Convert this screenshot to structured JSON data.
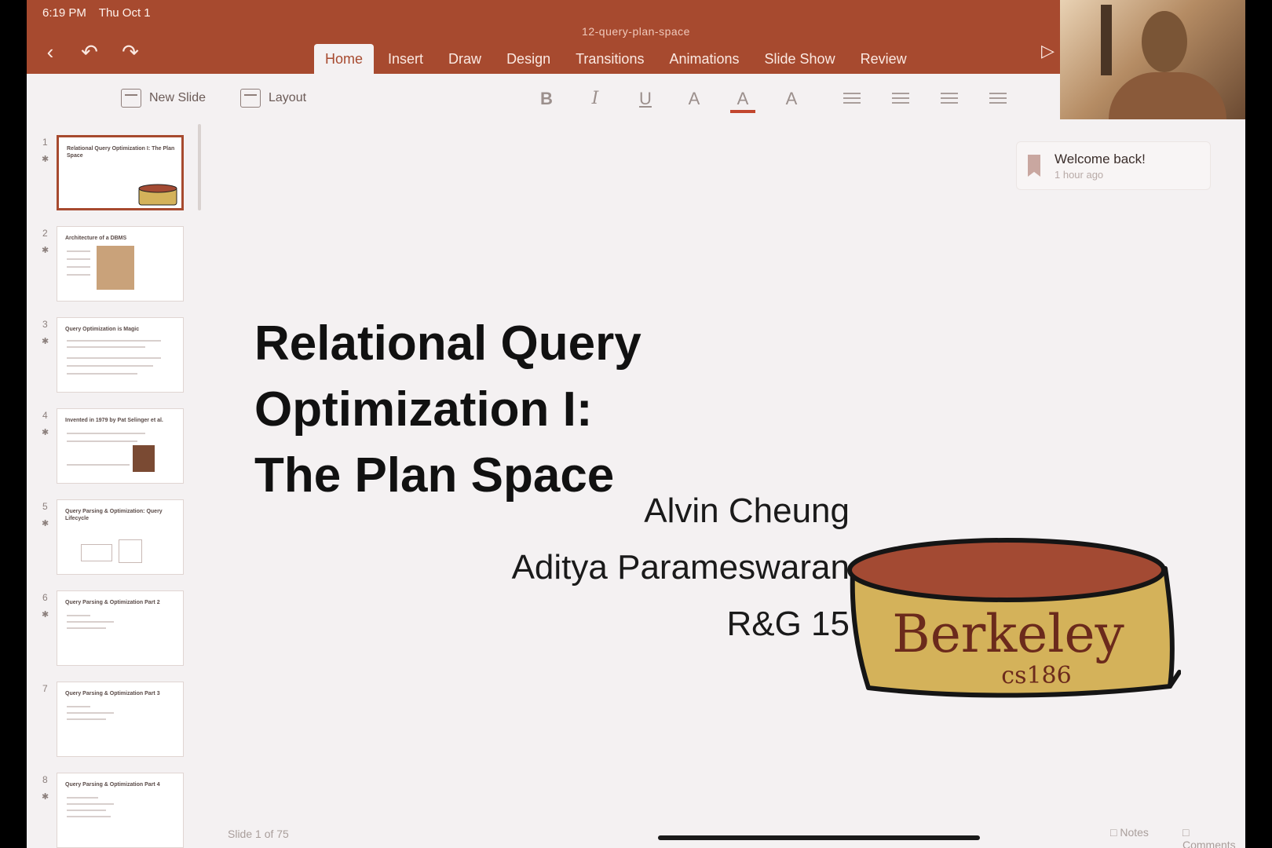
{
  "status": {
    "time": "6:19 PM",
    "date": "Thu Oct 1"
  },
  "document": {
    "title": "12-query-plan-space"
  },
  "ribbon": {
    "tabs": [
      {
        "label": "Home",
        "active": true
      },
      {
        "label": "Insert"
      },
      {
        "label": "Draw"
      },
      {
        "label": "Design"
      },
      {
        "label": "Transitions"
      },
      {
        "label": "Animations"
      },
      {
        "label": "Slide Show"
      },
      {
        "label": "Review"
      }
    ]
  },
  "toolbar": {
    "new_slide": "New Slide",
    "layout": "Layout",
    "bold": "B",
    "italic": "I",
    "underline": "U",
    "font_size": "A",
    "font_color": "A",
    "highlight": "A"
  },
  "thumbnails": [
    {
      "num": "1",
      "title": "Relational Query Optimization I: The Plan Space"
    },
    {
      "num": "2",
      "title": "Architecture of a DBMS"
    },
    {
      "num": "3",
      "title": "Query Optimization is Magic"
    },
    {
      "num": "4",
      "title": "Invented in 1979 by Pat Selinger et al."
    },
    {
      "num": "5",
      "title": "Query Parsing & Optimization: Query Lifecycle"
    },
    {
      "num": "6",
      "title": "Query Parsing & Optimization Part 2"
    },
    {
      "num": "7",
      "title": "Query Parsing & Optimization Part 3"
    },
    {
      "num": "8",
      "title": "Query Parsing & Optimization Part 4"
    }
  ],
  "slide": {
    "title_line1": "Relational Query",
    "title_line2": "Optimization I:",
    "title_line3": "The Plan Space",
    "author1": "Alvin Cheung",
    "author2": "Aditya Parameswaran",
    "reference": "R&G 15",
    "logo_text": "Berkeley",
    "logo_sub": "cs186"
  },
  "toast": {
    "message": "Welcome back!",
    "time": "1 hour ago"
  },
  "footer": {
    "slide_count": "Slide 1 of 75",
    "notes": "Notes",
    "comments": "Comments"
  },
  "colors": {
    "accent": "#a74a2f",
    "logo_fill": "#d4b25a",
    "logo_top": "#a34a33"
  }
}
